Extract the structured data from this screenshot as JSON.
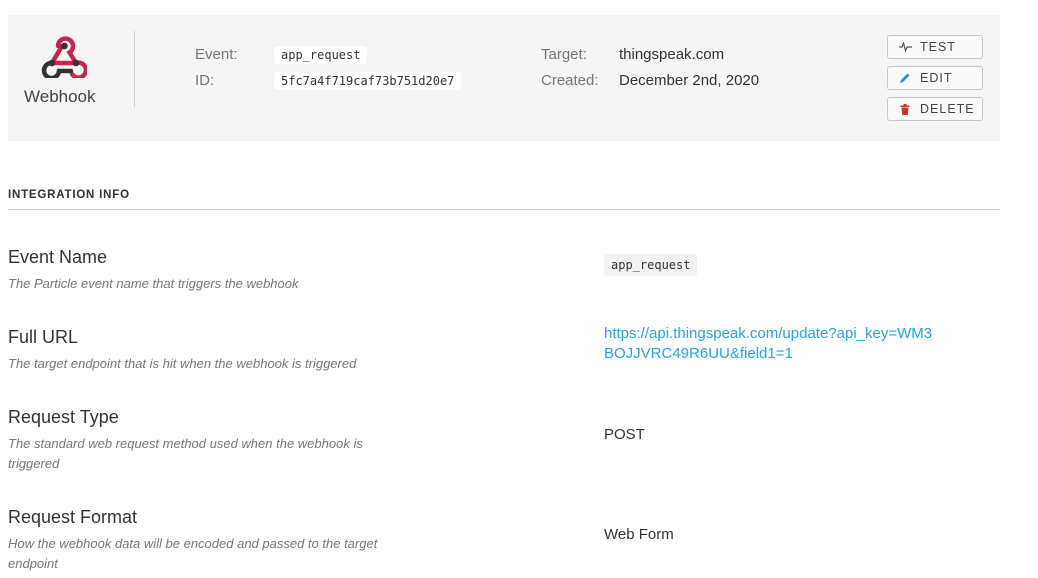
{
  "header": {
    "integration_type": "Webhook",
    "event_label": "Event:",
    "event_value": "app_request",
    "id_label": "ID:",
    "id_value": "5fc7a4f719caf73b751d20e7",
    "target_label": "Target:",
    "target_value": "thingspeak.com",
    "created_label": "Created:",
    "created_value": "December 2nd, 2020",
    "logo_icon": "webhook-icon",
    "logo_color": "#c7254e"
  },
  "actions": {
    "test_label": "TEST",
    "test_icon": "pulse-icon",
    "edit_label": "EDIT",
    "edit_icon": "pencil-icon",
    "edit_icon_color": "#2a8fd8",
    "delete_label": "DELETE",
    "delete_icon": "trash-icon",
    "delete_icon_color": "#c0392b"
  },
  "integration_info": {
    "section_title": "INTEGRATION INFO",
    "fields": [
      {
        "name": "Event Name",
        "description": "The Particle event name that triggers the webhook",
        "value": "app_request"
      },
      {
        "name": "Full URL",
        "description": "The target endpoint that is hit when the webhook is triggered",
        "value": "https://api.thingspeak.com/update?api_key=WM3BOJJVRC49R6UU&field1=1"
      },
      {
        "name": "Request Type",
        "description": "The standard web request method used when the webhook is triggered",
        "value": "POST"
      },
      {
        "name": "Request Format",
        "description": "How the webhook data will be encoded and passed to the target endpoint",
        "value": "Web Form"
      }
    ],
    "link_color": "#2aa3d8"
  }
}
